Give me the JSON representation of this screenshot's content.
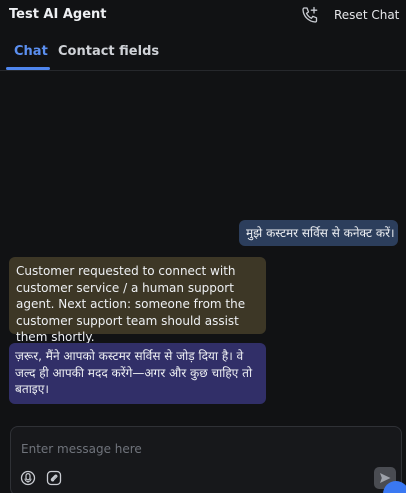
{
  "header": {
    "title": "Test AI Agent",
    "reset_label": "Reset Chat",
    "call_icon": "phone-plus-icon"
  },
  "tabs": [
    {
      "label": "Chat",
      "active": true
    },
    {
      "label": "Contact fields",
      "active": false
    }
  ],
  "messages": {
    "user": "मुझे कस्टमर सर्विस से कनेक्ट करें।",
    "system_note": "Customer requested to connect with customer service / a human support agent. Next action: someone from the customer support team should assist them shortly.",
    "agent": "ज़रूर, मैंने आपको कस्टमर सर्विस से जोड़ दिया है। वे जल्द ही आपकी मदद करेंगे—अगर और कुछ चाहिए तो बताइए।"
  },
  "composer": {
    "placeholder": "Enter message here",
    "mic_icon": "microphone-icon",
    "attach_icon": "attachment-icon",
    "send_icon": "send-icon"
  },
  "colors": {
    "background": "#111214",
    "accent": "#4f86ee",
    "user_bubble": "#2c3e5c",
    "system_bubble": "#3d3726",
    "agent_bubble": "#312f68"
  }
}
